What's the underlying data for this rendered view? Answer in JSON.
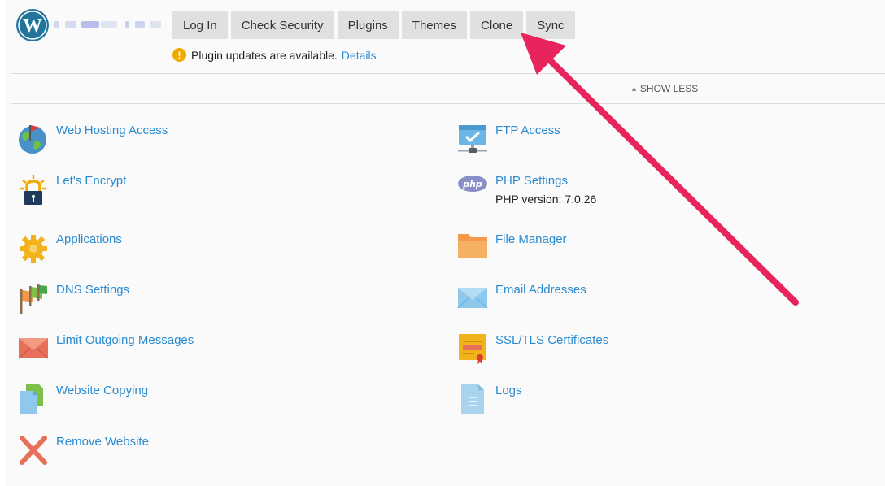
{
  "header": {
    "logo_icon": "wordpress-logo",
    "toolbar": [
      {
        "id": "login",
        "label": "Log In"
      },
      {
        "id": "check-security",
        "label": "Check Security"
      },
      {
        "id": "plugins",
        "label": "Plugins"
      },
      {
        "id": "themes",
        "label": "Themes"
      },
      {
        "id": "clone",
        "label": "Clone"
      },
      {
        "id": "sync",
        "label": "Sync"
      }
    ],
    "notice": {
      "icon": "warning-icon",
      "text": "Plugin updates are available.",
      "link": "Details"
    },
    "show_less": "SHOW LESS"
  },
  "tools_left": [
    {
      "icon": "globe-flag-icon",
      "label": "Web Hosting Access"
    },
    {
      "icon": "lock-icon",
      "label": "Let's Encrypt"
    },
    {
      "icon": "gear-icon",
      "label": "Applications"
    },
    {
      "icon": "dns-flags-icon",
      "label": "DNS Settings"
    },
    {
      "icon": "envelope-red-icon",
      "label": "Limit Outgoing Messages"
    },
    {
      "icon": "copy-doc-icon",
      "label": "Website Copying"
    },
    {
      "icon": "remove-x-icon",
      "label": "Remove Website"
    }
  ],
  "tools_right": [
    {
      "icon": "ftp-icon",
      "label": "FTP Access"
    },
    {
      "icon": "php-icon",
      "label": "PHP Settings",
      "sub": "PHP version: 7.0.26"
    },
    {
      "icon": "folder-icon",
      "label": "File Manager"
    },
    {
      "icon": "envelope-blue-icon",
      "label": "Email Addresses"
    },
    {
      "icon": "certificate-icon",
      "label": "SSL/TLS Certificates"
    },
    {
      "icon": "log-doc-icon",
      "label": "Logs"
    }
  ],
  "annotation": {
    "type": "arrow",
    "color": "#e8245c"
  },
  "colors": {
    "link": "#2b8ad0",
    "button_bg": "#e0e0e0",
    "warning": "#f2a900",
    "wp_blue": "#21759b"
  }
}
